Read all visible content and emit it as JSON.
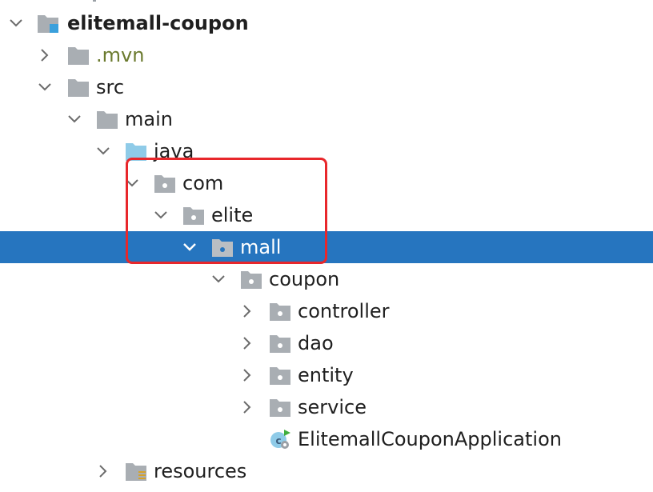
{
  "tree": {
    "items": [
      {
        "label": "elitemall-coupon",
        "icon": "module-folder-icon",
        "expanded": true,
        "bold": true
      },
      {
        "label": ".mvn",
        "icon": "folder-icon",
        "expanded": false
      },
      {
        "label": "src",
        "icon": "folder-icon",
        "expanded": true
      },
      {
        "label": "main",
        "icon": "folder-icon",
        "expanded": true
      },
      {
        "label": "java",
        "icon": "source-folder-icon",
        "expanded": true
      },
      {
        "label": "com",
        "icon": "package-icon",
        "expanded": true
      },
      {
        "label": "elite",
        "icon": "package-icon",
        "expanded": true
      },
      {
        "label": "mall",
        "icon": "package-icon",
        "expanded": true,
        "selected": true
      },
      {
        "label": "coupon",
        "icon": "package-icon",
        "expanded": true
      },
      {
        "label": "controller",
        "icon": "package-icon",
        "expanded": false
      },
      {
        "label": "dao",
        "icon": "package-icon",
        "expanded": false
      },
      {
        "label": "entity",
        "icon": "package-icon",
        "expanded": false
      },
      {
        "label": "service",
        "icon": "package-icon",
        "expanded": false
      },
      {
        "label": "ElitemallCouponApplication",
        "icon": "spring-boot-class-icon"
      },
      {
        "label": "resources",
        "icon": "resources-folder-icon",
        "expanded": false
      }
    ]
  },
  "colors": {
    "selection": "#2675bf",
    "highlight_border": "#e8272b",
    "folder": "#a9aeb3",
    "source_folder": "#8fcbe8",
    "module_marker": "#3aa0dc"
  }
}
